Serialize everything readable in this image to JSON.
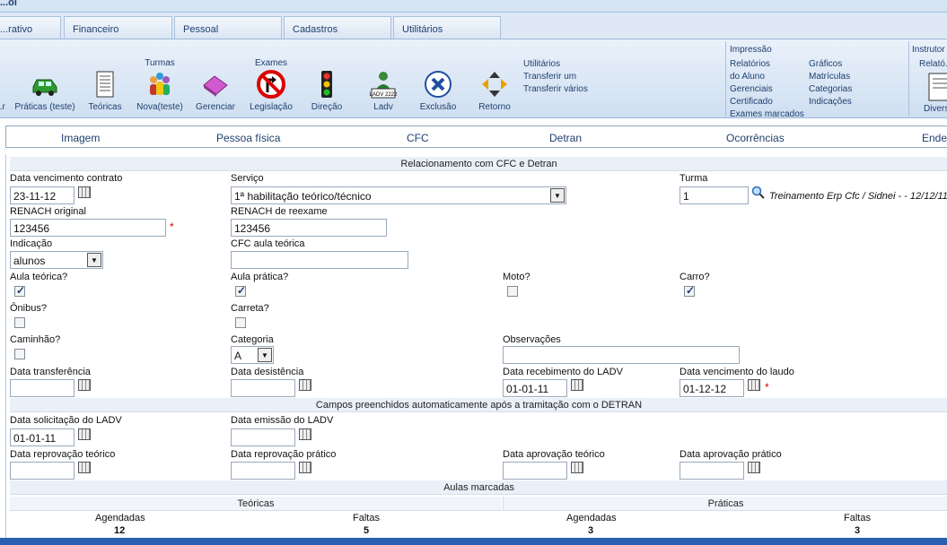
{
  "title": "...ol",
  "tabs": [
    "...rativo",
    "Financeiro",
    "Pessoal",
    "Cadastros",
    "Utilitários"
  ],
  "ribbon": {
    "buttons": [
      {
        "label": "...r",
        "icon": "partial-icon"
      },
      {
        "label": "Práticas (teste)",
        "icon": "car-icon"
      },
      {
        "label": "Teóricas",
        "icon": "notebook-icon"
      },
      {
        "label": "Nova(teste)",
        "group": "Turmas",
        "icon": "people-group-icon"
      },
      {
        "label": "Gerenciar",
        "icon": "eraser-icon"
      },
      {
        "label": "Legislação",
        "group": "Exames",
        "icon": "no-turn-sign-icon"
      },
      {
        "label": "Direção",
        "icon": "traffic-light-icon"
      },
      {
        "label": "Ladv",
        "icon": "ladv-user-icon"
      },
      {
        "label": "Exclusão",
        "icon": "delete-x-icon"
      },
      {
        "label": "Retorno",
        "icon": "return-arrows-icon"
      }
    ],
    "utilitarios": {
      "title": "Utilitários",
      "items": [
        "Transferir um",
        "Transferir vários"
      ]
    },
    "impressao": {
      "title": "Impressão",
      "col1": [
        "Relatórios",
        "do Aluno",
        "Gerenciais",
        "Certificado",
        "Exames marcados"
      ],
      "col2": [
        "Gráficos",
        "Matrículas",
        "Categorias",
        "Indicações"
      ]
    },
    "instrutor": {
      "title": "Instrutor",
      "items": [
        "Relató...",
        "Divers..."
      ]
    }
  },
  "nav": [
    "Imagem",
    "Pessoa física",
    "CFC",
    "Detran",
    "Ocorrências",
    "Ende..."
  ],
  "form": {
    "section1": "Relacionamento com CFC e Detran",
    "data_vencimento_contrato": {
      "label": "Data vencimento contrato",
      "value": "23-11-12"
    },
    "servico": {
      "label": "Serviço",
      "value": "1ª habilitação teórico/técnico"
    },
    "turma": {
      "label": "Turma",
      "value": "1",
      "info": "Treinamento Erp Cfc / Sidnei - - 12/12/11"
    },
    "renach_original": {
      "label": "RENACH original",
      "value": "123456"
    },
    "renach_reexame": {
      "label": "RENACH de reexame",
      "value": "123456"
    },
    "indicacao": {
      "label": "Indicação",
      "value": "alunos"
    },
    "cfc_aula_teorica": {
      "label": "CFC aula teórica",
      "value": ""
    },
    "aula_teorica": {
      "label": "Aula teórica?",
      "checked": true
    },
    "aula_pratica": {
      "label": "Aula prática?",
      "checked": true
    },
    "moto": {
      "label": "Moto?",
      "checked": false
    },
    "carro": {
      "label": "Carro?",
      "checked": true
    },
    "onibus": {
      "label": "Ônibus?",
      "checked": false
    },
    "carreta": {
      "label": "Carreta?",
      "checked": false
    },
    "caminhao": {
      "label": "Caminhão?",
      "checked": false
    },
    "categoria": {
      "label": "Categoria",
      "value": "A"
    },
    "observacoes": {
      "label": "Observações",
      "value": ""
    },
    "data_transferencia": {
      "label": "Data transferência",
      "value": ""
    },
    "data_desistencia": {
      "label": "Data desistência",
      "value": ""
    },
    "data_recebimento_ladv": {
      "label": "Data recebimento do LADV",
      "value": "01-01-11"
    },
    "data_vencimento_laudo": {
      "label": "Data vencimento do laudo",
      "value": "01-12-12"
    },
    "section2": "Campos preenchidos automaticamente após a tramitação com o DETRAN",
    "data_solicitacao_ladv": {
      "label": "Data solicitação do LADV",
      "value": "01-01-11"
    },
    "data_emissao_ladv": {
      "label": "Data emissão do LADV",
      "value": ""
    },
    "data_reprovacao_teorico": {
      "label": "Data reprovação teórico",
      "value": ""
    },
    "data_reprovacao_pratico": {
      "label": "Data reprovação prático",
      "value": ""
    },
    "data_aprovacao_teorico": {
      "label": "Data aprovação teórico",
      "value": ""
    },
    "data_aprovacao_pratico": {
      "label": "Data aprovação prático",
      "value": ""
    },
    "section3": "Aulas marcadas",
    "teoricas": "Teóricas",
    "praticas": "Práticas",
    "agendadas_label": "Agendadas",
    "faltas_label": "Faltas",
    "teoricas_agendadas": "12",
    "teoricas_faltas": "5",
    "praticas_agendadas": "3",
    "praticas_faltas": "3"
  },
  "colors": {
    "accent": "#1e3f6e",
    "ribbon": "#cfdff1",
    "required": "#dd0000"
  }
}
